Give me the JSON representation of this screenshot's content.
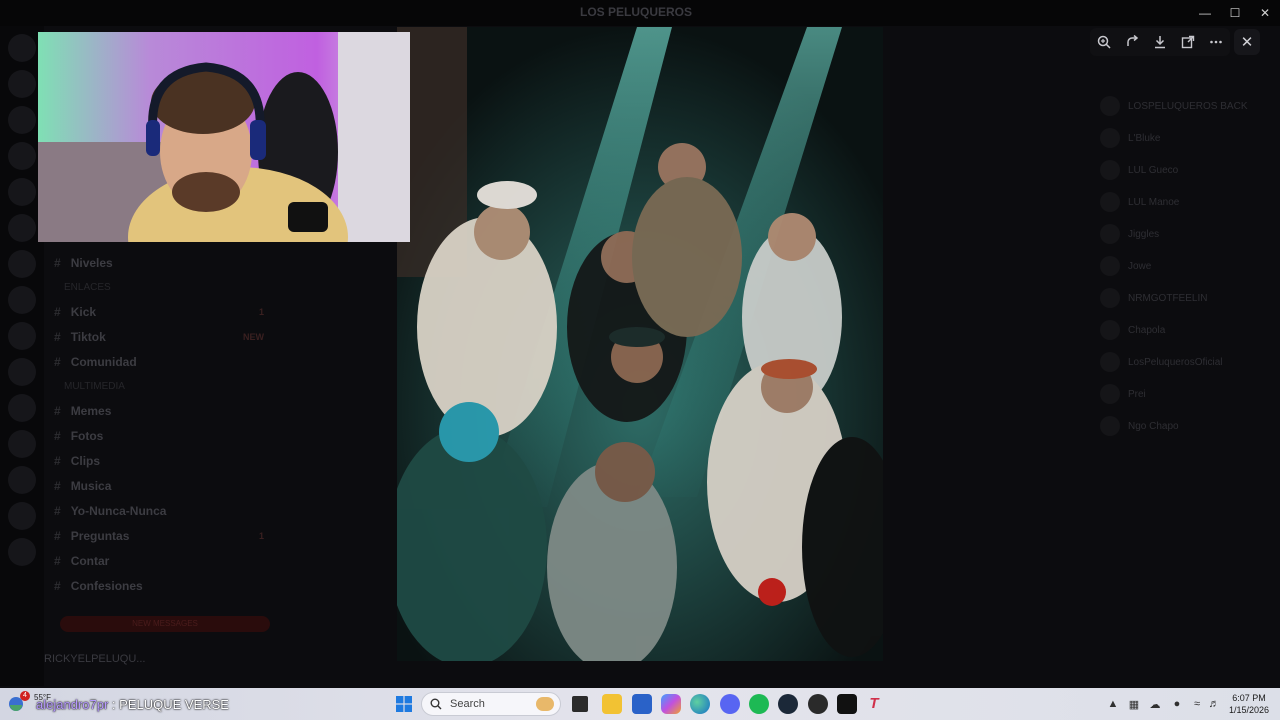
{
  "window": {
    "title": "LOS PELUQUEROS",
    "minimize_glyph": "—",
    "maximize_glyph": "☐",
    "close_glyph": "✕"
  },
  "channels": [
    {
      "name": "Niveles",
      "badge": ""
    },
    {
      "category": "ENLACES"
    },
    {
      "name": "Kick",
      "badge": "1"
    },
    {
      "name": "Tiktok",
      "badge": "NEW"
    },
    {
      "name": "Comunidad",
      "badge": ""
    },
    {
      "category": "MULTIMEDIA"
    },
    {
      "name": "Memes",
      "badge": ""
    },
    {
      "name": "Fotos",
      "badge": ""
    },
    {
      "name": "Clips",
      "badge": ""
    },
    {
      "name": "Musica",
      "badge": ""
    },
    {
      "name": "Yo-Nunca-Nunca",
      "badge": ""
    },
    {
      "name": "Preguntas",
      "badge": "1"
    },
    {
      "name": "Contar",
      "badge": ""
    },
    {
      "name": "Confesiones",
      "badge": ""
    }
  ],
  "unread_pill": "NEW MESSAGES",
  "user_panel": {
    "name": "RICKYELPELUQU..."
  },
  "members": [
    "LOSPELUQUEROS BACK",
    "L'Bluke",
    "LUL Gueco",
    "LUL Manoe",
    "Jiggles",
    "Jowe",
    "NRMGOTFEELIN",
    "Chapola",
    "LosPeluquerosOficial",
    "Prei",
    "Ngo Chapo"
  ],
  "viewer_tools": [
    "zoom-icon",
    "rotate-icon",
    "download-icon",
    "open-external-icon",
    "more-icon"
  ],
  "viewer_close": "✕",
  "taskbar": {
    "temp": "55°F",
    "now_playing_user": "alejandro7pr",
    "now_playing_text": " : PELUQUE VERSE",
    "search_placeholder": "Search",
    "notification_count": "4",
    "time": "6:07 PM",
    "date": "1/15/2026"
  }
}
